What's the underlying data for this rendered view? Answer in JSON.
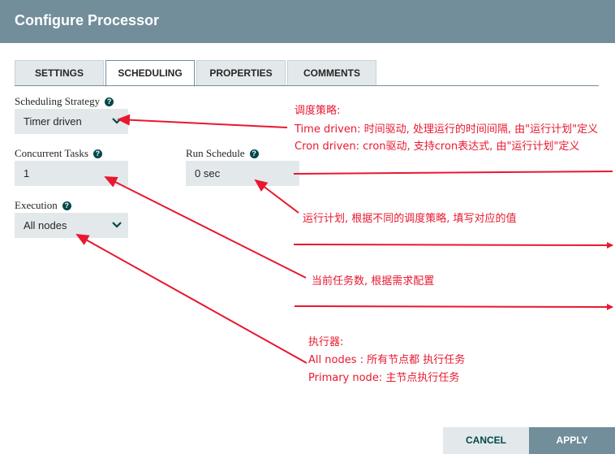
{
  "dialog": {
    "title": "Configure Processor"
  },
  "tabs": [
    {
      "label": "SETTINGS",
      "selected": false
    },
    {
      "label": "SCHEDULING",
      "selected": true
    },
    {
      "label": "PROPERTIES",
      "selected": false
    },
    {
      "label": "COMMENTS",
      "selected": false
    }
  ],
  "scheduling_strategy": {
    "label": "Scheduling Strategy",
    "value": "Timer driven"
  },
  "concurrent_tasks": {
    "label": "Concurrent Tasks",
    "value": "1"
  },
  "run_schedule": {
    "label": "Run Schedule",
    "value": "0 sec"
  },
  "execution": {
    "label": "Execution",
    "value": "All nodes"
  },
  "annotations": {
    "strategy_title": "调度策略:",
    "strategy_timer": "Time driven: 时间驱动, 处理运行的时间间隔, 由\"运行计划\"定义",
    "strategy_cron": "Cron driven: cron驱动, 支持cron表达式, 由\"运行计划\"定义",
    "run_schedule_note": "运行计划, 根据不同的调度策略, 填写对应的值",
    "concurrent_note": "当前任务数, 根据需求配置",
    "execution_title": "执行器:",
    "execution_all": "All nodes : 所有节点都 执行任务",
    "execution_primary": "Primary node:  主节点执行任务"
  },
  "buttons": {
    "cancel": "CANCEL",
    "apply": "APPLY"
  },
  "colors": {
    "header": "#728e9b",
    "annotation": "#e8182f",
    "field_bg": "#e3e8eb",
    "help_icon": "#004849"
  }
}
